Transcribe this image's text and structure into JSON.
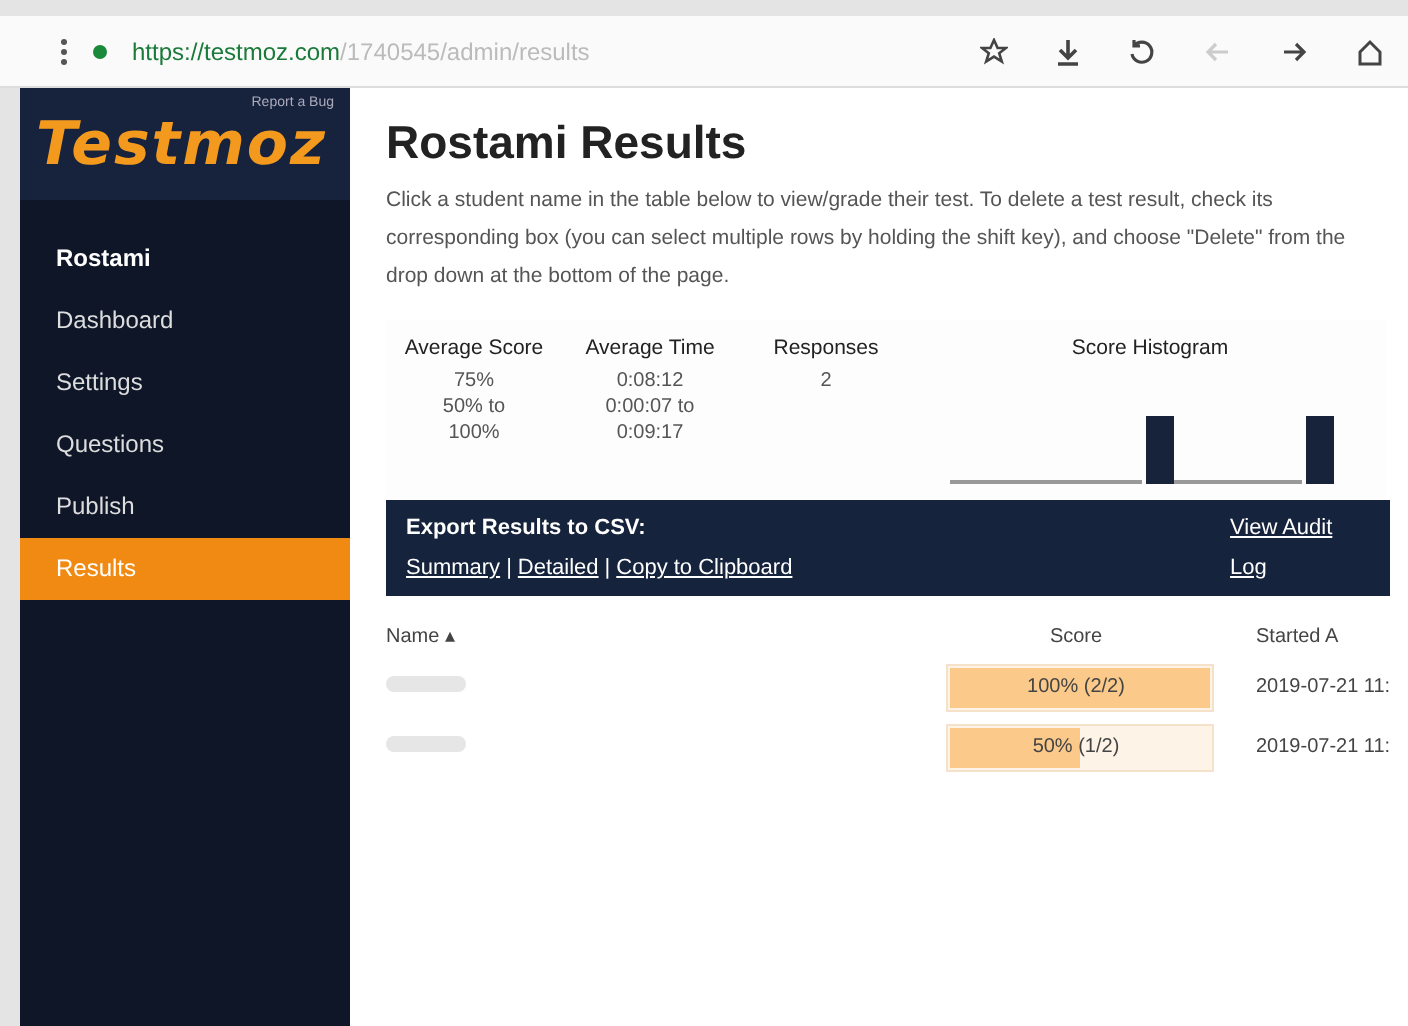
{
  "browser": {
    "url_host": "https://testmoz.com",
    "url_path": "/1740545/admin/results"
  },
  "sidebar": {
    "top_link": "Report a Bug",
    "logo": "Testmoz",
    "items": [
      {
        "label": "Rostami",
        "selected": false,
        "kind": "title"
      },
      {
        "label": "Dashboard",
        "selected": false,
        "kind": "link"
      },
      {
        "label": "Settings",
        "selected": false,
        "kind": "link"
      },
      {
        "label": "Questions",
        "selected": false,
        "kind": "link"
      },
      {
        "label": "Publish",
        "selected": false,
        "kind": "link"
      },
      {
        "label": "Results",
        "selected": true,
        "kind": "link"
      }
    ]
  },
  "page": {
    "title": "Rostami Results",
    "intro": "Click a student name in the table below to view/grade their test. To delete a test result, check its corresponding box (you can select multiple rows by holding the shift key), and choose \"Delete\" from the drop down at the bottom of the page."
  },
  "stats": [
    {
      "heading": "Average Score",
      "lines": [
        "75%",
        "50% to",
        "100%"
      ]
    },
    {
      "heading": "Average Time",
      "lines": [
        "0:08:12",
        "0:00:07 to",
        "0:09:17"
      ]
    },
    {
      "heading": "Responses",
      "lines": [
        "2"
      ]
    }
  ],
  "histogram": {
    "title": "Score Histogram"
  },
  "export_bar": {
    "label": "Export Results to CSV:",
    "links": [
      "Summary",
      "Detailed"
    ],
    "separator": "|",
    "copy": "Copy to Clipboard",
    "audit": "View Audit Log"
  },
  "table": {
    "columns": [
      "Name ▴",
      "Score",
      "Started A"
    ],
    "rows": [
      {
        "score": "100% (2/2)",
        "level": 1.0,
        "started": "2019-07-21 11:"
      },
      {
        "score": "50% (1/2)",
        "level": 0.5,
        "started": "2019-07-21 11:"
      }
    ]
  }
}
